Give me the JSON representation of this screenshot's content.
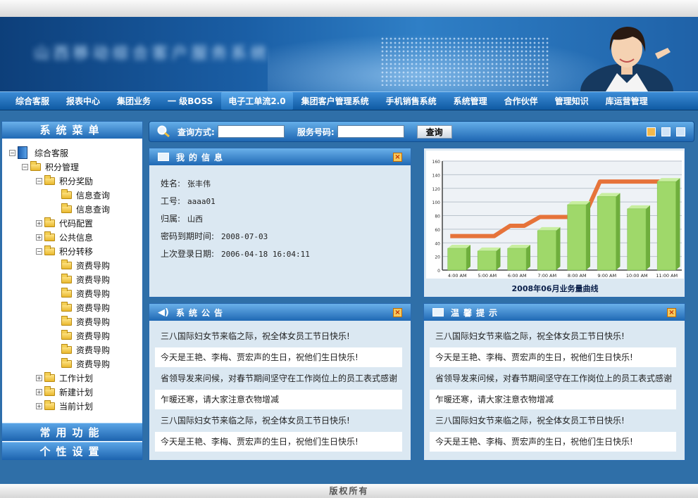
{
  "banner": {
    "title": "山西移动综合客户服务系统"
  },
  "nav": [
    "综合客服",
    "报表中心",
    "集团业务",
    "一 级BOSS",
    "电子工单流2.0",
    "集团客户管理系统",
    "手机销售系统",
    "系统管理",
    "合作伙伴",
    "管理知识",
    "库运营管理"
  ],
  "sidebar": {
    "header": "系统菜单",
    "tree": [
      {
        "label": "综合客服",
        "level": 0,
        "type": "root",
        "toggle": "-"
      },
      {
        "label": "积分管理",
        "level": 1,
        "type": "folder",
        "toggle": "-"
      },
      {
        "label": "积分奖励",
        "level": 2,
        "type": "folder",
        "toggle": "-"
      },
      {
        "label": "信息查询",
        "level": 3,
        "type": "folder",
        "toggle": ""
      },
      {
        "label": "信息查询",
        "level": 3,
        "type": "folder",
        "toggle": ""
      },
      {
        "label": "代码配置",
        "level": 2,
        "type": "folder",
        "toggle": "+"
      },
      {
        "label": "公共信息",
        "level": 2,
        "type": "folder",
        "toggle": "+"
      },
      {
        "label": "积分转移",
        "level": 2,
        "type": "folder",
        "toggle": "-"
      },
      {
        "label": "资费导购",
        "level": 3,
        "type": "folder",
        "toggle": ""
      },
      {
        "label": "资费导购",
        "level": 3,
        "type": "folder",
        "toggle": ""
      },
      {
        "label": "资费导购",
        "level": 3,
        "type": "folder",
        "toggle": ""
      },
      {
        "label": "资费导购",
        "level": 3,
        "type": "folder",
        "toggle": ""
      },
      {
        "label": "资费导购",
        "level": 3,
        "type": "folder",
        "toggle": ""
      },
      {
        "label": "资费导购",
        "level": 3,
        "type": "folder",
        "toggle": ""
      },
      {
        "label": "资费导购",
        "level": 3,
        "type": "folder",
        "toggle": ""
      },
      {
        "label": "资费导购",
        "level": 3,
        "type": "folder",
        "toggle": ""
      },
      {
        "label": "工作计划",
        "level": 2,
        "type": "folder",
        "toggle": "+"
      },
      {
        "label": "新建计划",
        "level": 2,
        "type": "folder",
        "toggle": "+"
      },
      {
        "label": "当前计划",
        "level": 2,
        "type": "folder",
        "toggle": "+"
      }
    ],
    "footer1": "常用功能",
    "footer2": "个性设置"
  },
  "search": {
    "mode_label": "查询方式:",
    "number_label": "服务号码:",
    "button": "查询"
  },
  "myinfo": {
    "title": "我的信息",
    "rows": [
      {
        "k": "姓名:",
        "v": "张丰伟"
      },
      {
        "k": "工号:",
        "v": "aaaa01"
      },
      {
        "k": "归属:",
        "v": "山西"
      },
      {
        "k": "密码到期时间:",
        "v": "2008-07-03"
      },
      {
        "k": "上次登录日期:",
        "v": "2006-04-18 16:04:11"
      }
    ]
  },
  "chart_data": {
    "type": "bar",
    "title": "2008年06月业务量曲线",
    "categories": [
      "4:00 AM",
      "5:00 AM",
      "6:00 AM",
      "7:00 AM",
      "8:00 AM",
      "9:00 AM",
      "10:00 AM",
      "11:00 AM"
    ],
    "series": [
      {
        "values": [
          32,
          28,
          32,
          58,
          96,
          108,
          90,
          130
        ]
      },
      {
        "values": [
          50,
          50,
          65,
          78,
          78,
          130,
          130,
          130
        ]
      }
    ],
    "yticks": [
      0,
      20,
      40,
      60,
      80,
      100,
      120,
      140,
      160
    ],
    "ylim": [
      0,
      160
    ],
    "colors": {
      "bar": "#9fd86a",
      "line": "#e6733a"
    }
  },
  "notice": {
    "title": "系统公告",
    "items": [
      "三八国际妇女节来临之际，祝全体女员工节日快乐!",
      "今天是王艳、李梅、贾宏声的生日，祝他们生日快乐!",
      "省领导发来问候，对春节期间坚守在工作岗位上的员工表式感谢",
      "乍暖还寒，请大家注意衣物增减",
      " 三八国际妇女节来临之际，祝全体女员工节日快乐!",
      "今天是王艳、李梅、贾宏声的生日，祝他们生日快乐!"
    ]
  },
  "tips": {
    "title": "温馨提示",
    "items": [
      "三八国际妇女节来临之际，祝全体女员工节日快乐!",
      "今天是王艳、李梅、贾宏声的生日，祝他们生日快乐!",
      "省领导发来问候，对春节期间坚守在工作岗位上的员工表式感谢",
      "乍暖还寒，请大家注意衣物增减",
      " 三八国际妇女节来临之际，祝全体女员工节日快乐!",
      "今天是王艳、李梅、贾宏声的生日，祝他们生日快乐!"
    ]
  },
  "footer": {
    "copyright": "版权所有"
  }
}
